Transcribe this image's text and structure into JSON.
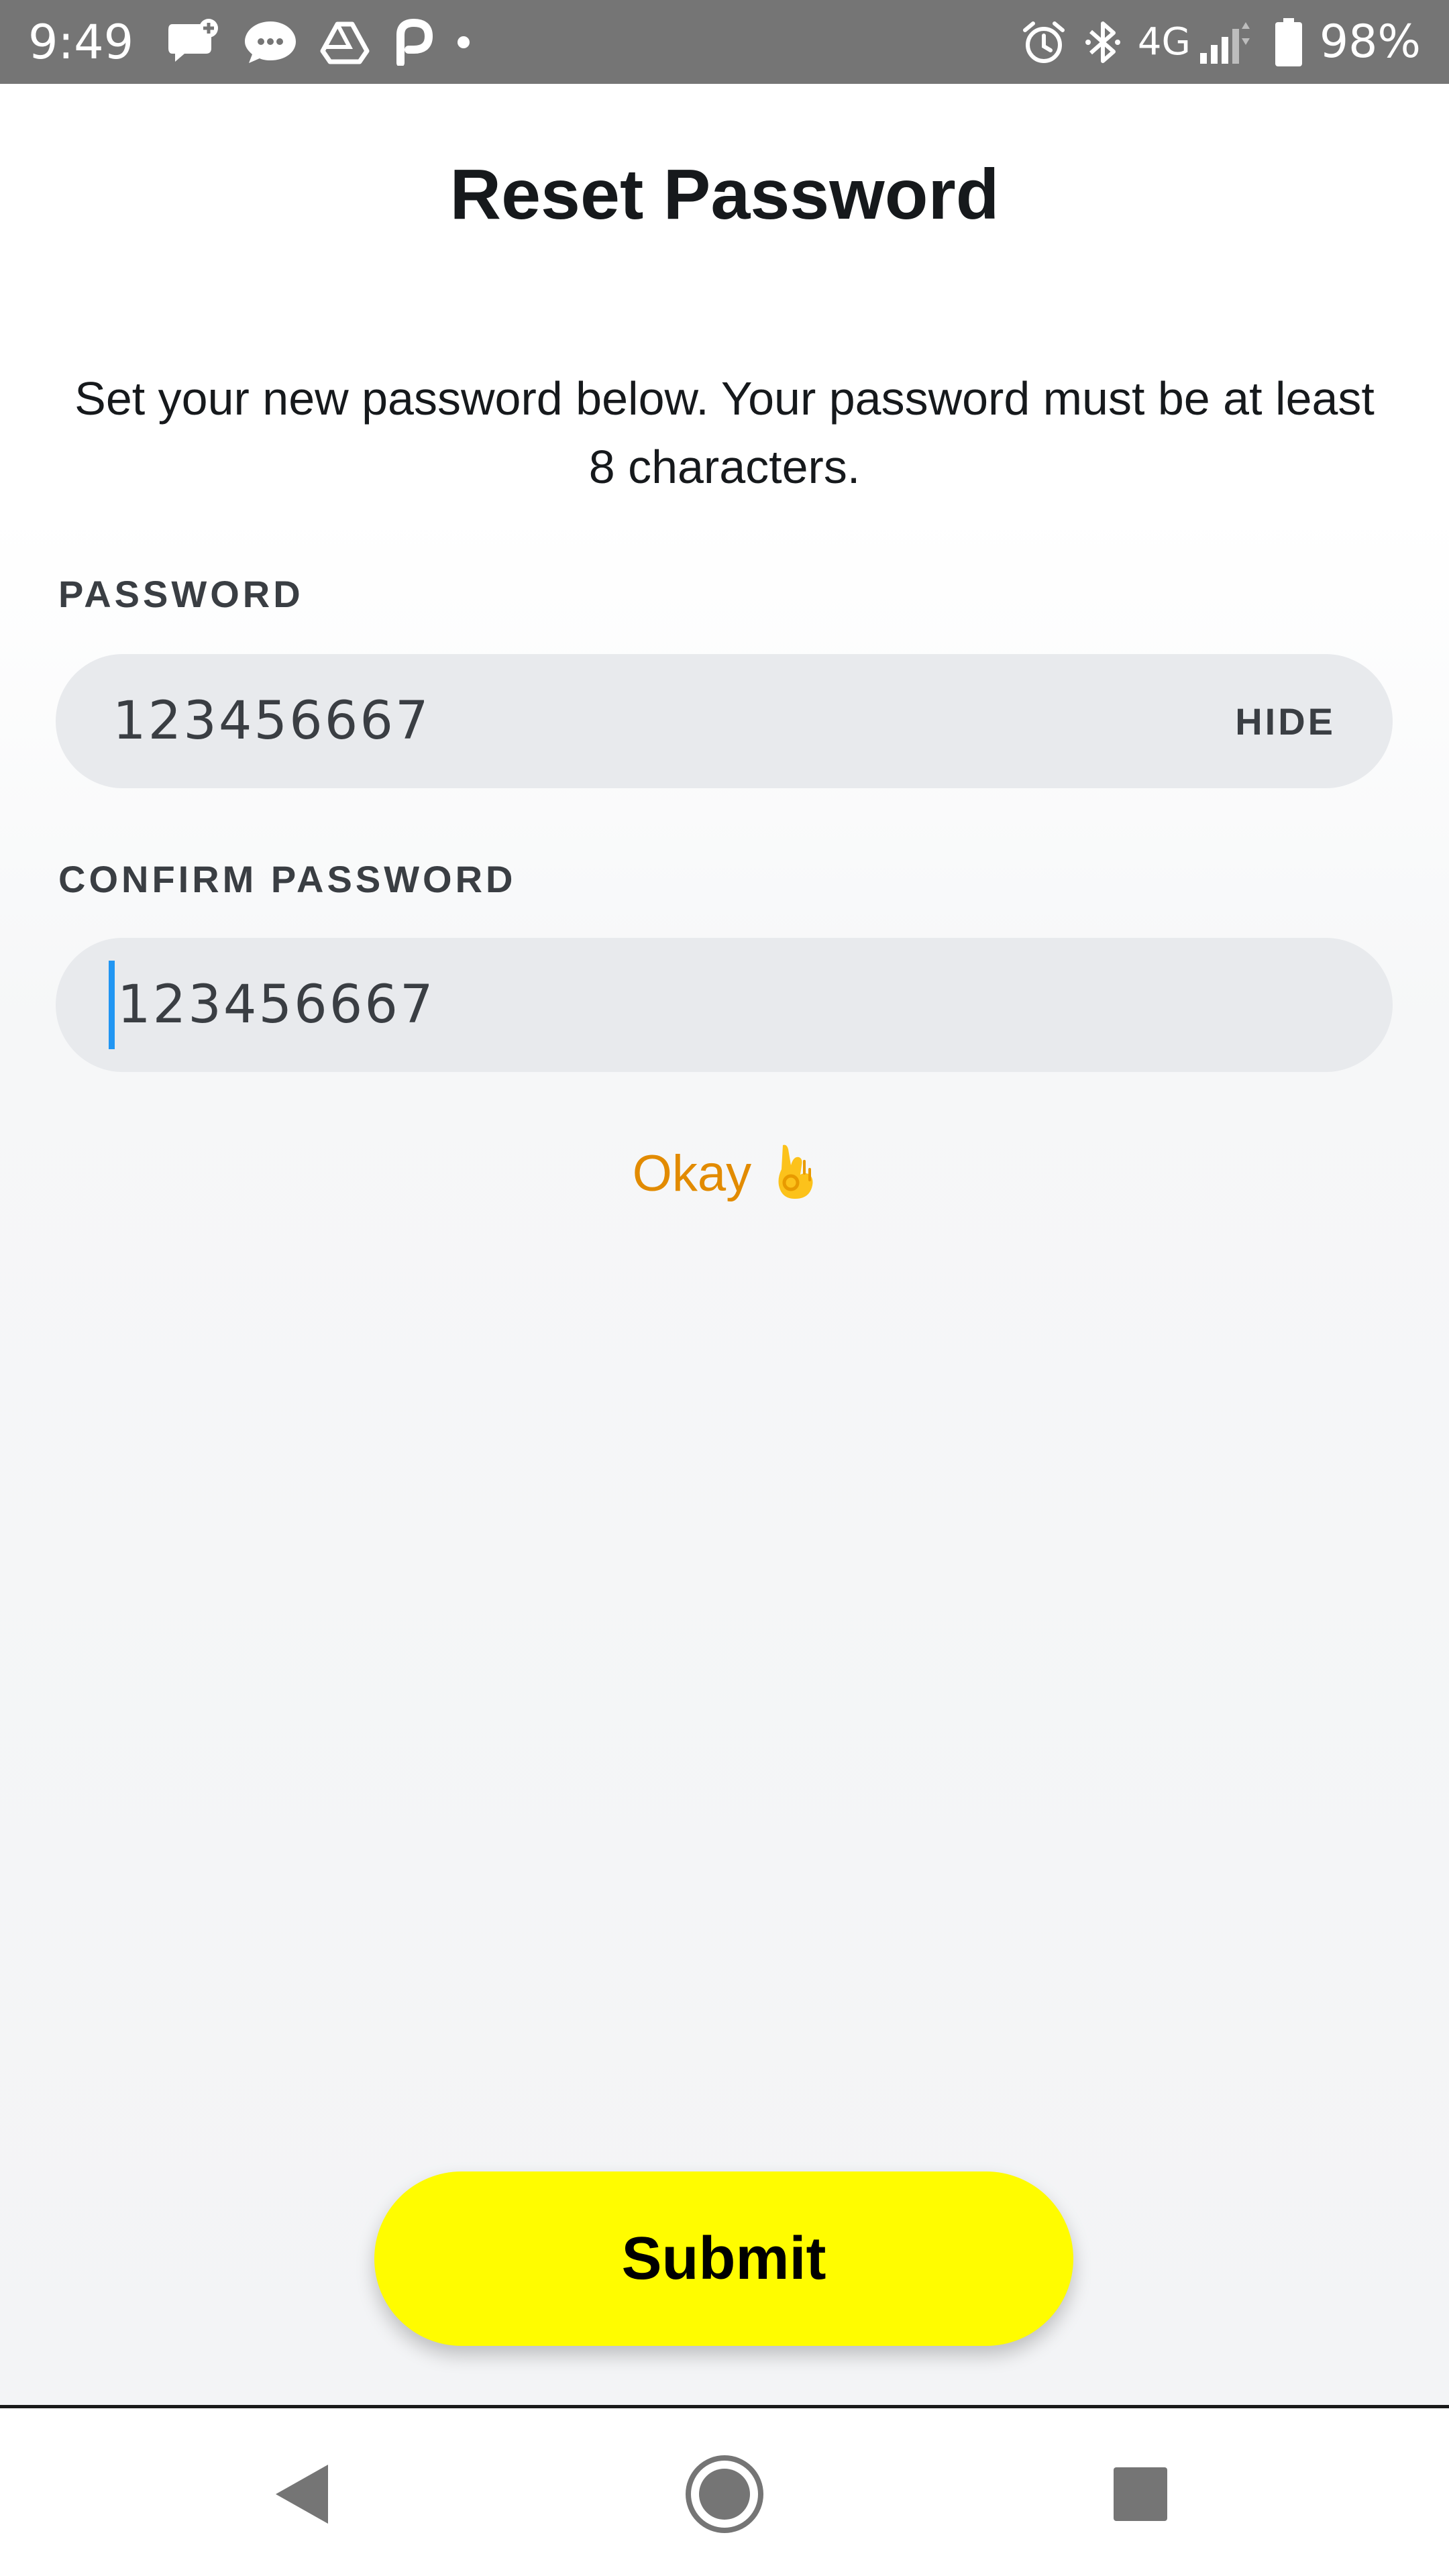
{
  "status_bar": {
    "time": "9:49",
    "network": "4G",
    "battery": "98%",
    "icons": [
      "add-chat-icon",
      "messages-icon",
      "drive-icon",
      "p-app-icon",
      "dot-icon",
      "alarm-icon",
      "bluetooth-icon",
      "signal-icon",
      "battery-icon"
    ]
  },
  "page": {
    "title": "Reset Password",
    "subtitle": "Set your new password below. Your password must be at least 8 characters."
  },
  "password_field": {
    "label": "PASSWORD",
    "value": "123456667",
    "toggle": "HIDE"
  },
  "confirm_field": {
    "label": "CONFIRM PASSWORD",
    "value": "123456667"
  },
  "strength": {
    "text": "Okay",
    "emoji_icon": "ok-hand-icon",
    "color": "#e28b00"
  },
  "submit": {
    "label": "Submit",
    "color": "#fffc00"
  },
  "nav_bar": {
    "icons": [
      "back-icon",
      "home-icon",
      "recents-icon"
    ]
  }
}
